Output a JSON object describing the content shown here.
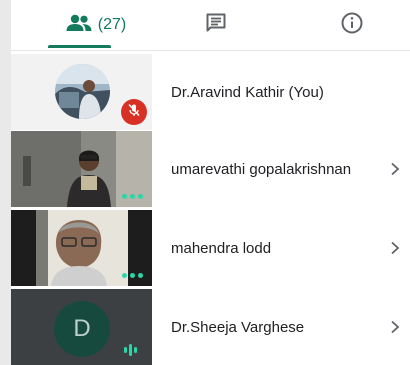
{
  "tabs": {
    "people_count": "(27)",
    "people_icon": "people-icon",
    "chat_icon": "chat-icon",
    "info_icon": "info-icon",
    "accent": "#137a5d"
  },
  "participants": [
    {
      "name": "Dr.Aravind Kathir (You)",
      "muted": true,
      "tile": "photo-avatar"
    },
    {
      "name": "umarevathi gopalakrishnan",
      "tile": "video"
    },
    {
      "name": "mahendra lodd",
      "tile": "video"
    },
    {
      "name": "Dr.Sheeja Varghese",
      "tile": "initial-avatar",
      "initial": "D",
      "speaking": true
    }
  ],
  "colors": {
    "mute_badge": "#d93025",
    "activity_dots": "#2bd6a8",
    "tile_background": "#f2f2f2",
    "initial_avatar": "#174a3e"
  }
}
